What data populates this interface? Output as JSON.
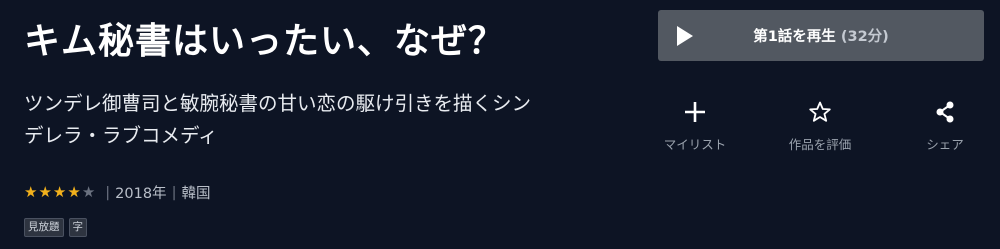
{
  "title": "キム秘書はいったい、なぜ？",
  "description": "ツンデレ御曹司と敏腕秘書の甘い恋の駆け引きを描くシンデレラ・ラブコメディ",
  "rating": {
    "value": 4,
    "max": 5
  },
  "meta": {
    "year": "2018年",
    "country": "韓国"
  },
  "badges": [
    "見放題",
    "字"
  ],
  "play": {
    "label": "第1話を再生",
    "duration": "(32分)"
  },
  "actions": [
    {
      "label": "マイリスト",
      "icon": "plus-icon"
    },
    {
      "label": "作品を評価",
      "icon": "star-outline-icon"
    },
    {
      "label": "シェア",
      "icon": "share-icon"
    }
  ],
  "colors": {
    "background": "#0d1424",
    "star": "#f2b11c",
    "play_button": "#525861"
  }
}
